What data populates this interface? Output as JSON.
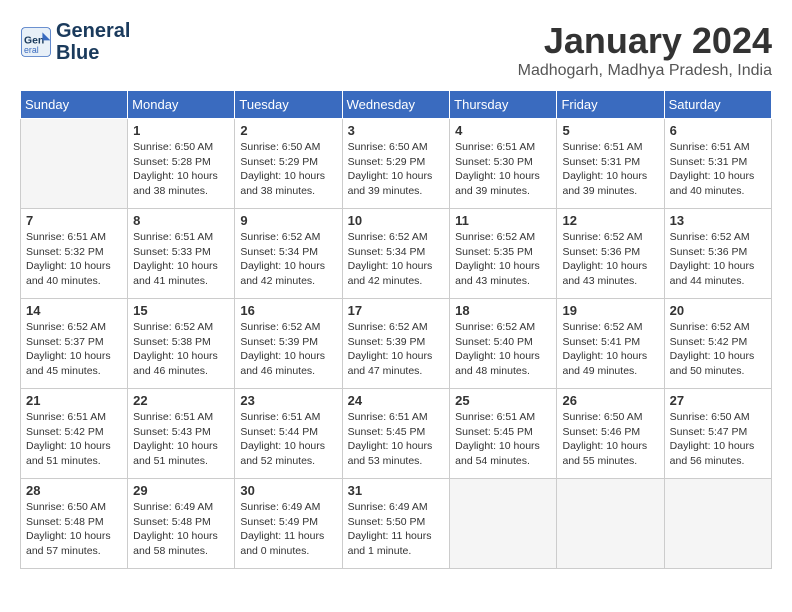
{
  "header": {
    "logo_line1": "General",
    "logo_line2": "Blue",
    "month_title": "January 2024",
    "location": "Madhogarh, Madhya Pradesh, India"
  },
  "weekdays": [
    "Sunday",
    "Monday",
    "Tuesday",
    "Wednesday",
    "Thursday",
    "Friday",
    "Saturday"
  ],
  "weeks": [
    [
      {
        "day": "",
        "empty": true
      },
      {
        "day": "1",
        "sunrise": "6:50 AM",
        "sunset": "5:28 PM",
        "daylight": "10 hours and 38 minutes."
      },
      {
        "day": "2",
        "sunrise": "6:50 AM",
        "sunset": "5:29 PM",
        "daylight": "10 hours and 38 minutes."
      },
      {
        "day": "3",
        "sunrise": "6:50 AM",
        "sunset": "5:29 PM",
        "daylight": "10 hours and 39 minutes."
      },
      {
        "day": "4",
        "sunrise": "6:51 AM",
        "sunset": "5:30 PM",
        "daylight": "10 hours and 39 minutes."
      },
      {
        "day": "5",
        "sunrise": "6:51 AM",
        "sunset": "5:31 PM",
        "daylight": "10 hours and 39 minutes."
      },
      {
        "day": "6",
        "sunrise": "6:51 AM",
        "sunset": "5:31 PM",
        "daylight": "10 hours and 40 minutes."
      }
    ],
    [
      {
        "day": "7",
        "sunrise": "6:51 AM",
        "sunset": "5:32 PM",
        "daylight": "10 hours and 40 minutes."
      },
      {
        "day": "8",
        "sunrise": "6:51 AM",
        "sunset": "5:33 PM",
        "daylight": "10 hours and 41 minutes."
      },
      {
        "day": "9",
        "sunrise": "6:52 AM",
        "sunset": "5:34 PM",
        "daylight": "10 hours and 42 minutes."
      },
      {
        "day": "10",
        "sunrise": "6:52 AM",
        "sunset": "5:34 PM",
        "daylight": "10 hours and 42 minutes."
      },
      {
        "day": "11",
        "sunrise": "6:52 AM",
        "sunset": "5:35 PM",
        "daylight": "10 hours and 43 minutes."
      },
      {
        "day": "12",
        "sunrise": "6:52 AM",
        "sunset": "5:36 PM",
        "daylight": "10 hours and 43 minutes."
      },
      {
        "day": "13",
        "sunrise": "6:52 AM",
        "sunset": "5:36 PM",
        "daylight": "10 hours and 44 minutes."
      }
    ],
    [
      {
        "day": "14",
        "sunrise": "6:52 AM",
        "sunset": "5:37 PM",
        "daylight": "10 hours and 45 minutes."
      },
      {
        "day": "15",
        "sunrise": "6:52 AM",
        "sunset": "5:38 PM",
        "daylight": "10 hours and 46 minutes."
      },
      {
        "day": "16",
        "sunrise": "6:52 AM",
        "sunset": "5:39 PM",
        "daylight": "10 hours and 46 minutes."
      },
      {
        "day": "17",
        "sunrise": "6:52 AM",
        "sunset": "5:39 PM",
        "daylight": "10 hours and 47 minutes."
      },
      {
        "day": "18",
        "sunrise": "6:52 AM",
        "sunset": "5:40 PM",
        "daylight": "10 hours and 48 minutes."
      },
      {
        "day": "19",
        "sunrise": "6:52 AM",
        "sunset": "5:41 PM",
        "daylight": "10 hours and 49 minutes."
      },
      {
        "day": "20",
        "sunrise": "6:52 AM",
        "sunset": "5:42 PM",
        "daylight": "10 hours and 50 minutes."
      }
    ],
    [
      {
        "day": "21",
        "sunrise": "6:51 AM",
        "sunset": "5:42 PM",
        "daylight": "10 hours and 51 minutes."
      },
      {
        "day": "22",
        "sunrise": "6:51 AM",
        "sunset": "5:43 PM",
        "daylight": "10 hours and 51 minutes."
      },
      {
        "day": "23",
        "sunrise": "6:51 AM",
        "sunset": "5:44 PM",
        "daylight": "10 hours and 52 minutes."
      },
      {
        "day": "24",
        "sunrise": "6:51 AM",
        "sunset": "5:45 PM",
        "daylight": "10 hours and 53 minutes."
      },
      {
        "day": "25",
        "sunrise": "6:51 AM",
        "sunset": "5:45 PM",
        "daylight": "10 hours and 54 minutes."
      },
      {
        "day": "26",
        "sunrise": "6:50 AM",
        "sunset": "5:46 PM",
        "daylight": "10 hours and 55 minutes."
      },
      {
        "day": "27",
        "sunrise": "6:50 AM",
        "sunset": "5:47 PM",
        "daylight": "10 hours and 56 minutes."
      }
    ],
    [
      {
        "day": "28",
        "sunrise": "6:50 AM",
        "sunset": "5:48 PM",
        "daylight": "10 hours and 57 minutes."
      },
      {
        "day": "29",
        "sunrise": "6:49 AM",
        "sunset": "5:48 PM",
        "daylight": "10 hours and 58 minutes."
      },
      {
        "day": "30",
        "sunrise": "6:49 AM",
        "sunset": "5:49 PM",
        "daylight": "11 hours and 0 minutes."
      },
      {
        "day": "31",
        "sunrise": "6:49 AM",
        "sunset": "5:50 PM",
        "daylight": "11 hours and 1 minute."
      },
      {
        "day": "",
        "empty": true
      },
      {
        "day": "",
        "empty": true
      },
      {
        "day": "",
        "empty": true
      }
    ]
  ]
}
